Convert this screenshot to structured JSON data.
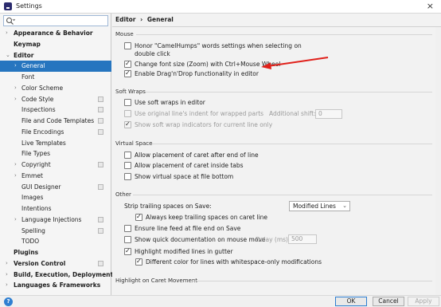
{
  "window": {
    "title": "Settings"
  },
  "search": {
    "placeholder": ""
  },
  "breadcrumb": {
    "parent": "Editor",
    "separator": "›",
    "current": "General"
  },
  "sidebar": {
    "items": [
      {
        "label": "Appearance & Behavior",
        "arrow": "›",
        "bold": true
      },
      {
        "label": "Keymap",
        "arrow": "",
        "bold": true
      },
      {
        "label": "Editor",
        "arrow": "⌄",
        "bold": true
      },
      {
        "label": "General",
        "arrow": "›",
        "bold": false,
        "selected": true
      },
      {
        "label": "Font",
        "arrow": "",
        "bold": false
      },
      {
        "label": "Color Scheme",
        "arrow": "›",
        "bold": false
      },
      {
        "label": "Code Style",
        "arrow": "›",
        "bold": false,
        "copy": true
      },
      {
        "label": "Inspections",
        "arrow": "",
        "bold": false,
        "copy": true
      },
      {
        "label": "File and Code Templates",
        "arrow": "",
        "bold": false,
        "copy": true
      },
      {
        "label": "File Encodings",
        "arrow": "",
        "bold": false,
        "copy": true
      },
      {
        "label": "Live Templates",
        "arrow": "",
        "bold": false
      },
      {
        "label": "File Types",
        "arrow": "",
        "bold": false
      },
      {
        "label": "Copyright",
        "arrow": "›",
        "bold": false,
        "copy": true
      },
      {
        "label": "Emmet",
        "arrow": "›",
        "bold": false
      },
      {
        "label": "GUI Designer",
        "arrow": "",
        "bold": false,
        "copy": true
      },
      {
        "label": "Images",
        "arrow": "",
        "bold": false
      },
      {
        "label": "Intentions",
        "arrow": "",
        "bold": false
      },
      {
        "label": "Language Injections",
        "arrow": "›",
        "bold": false,
        "copy": true
      },
      {
        "label": "Spelling",
        "arrow": "",
        "bold": false,
        "copy": true
      },
      {
        "label": "TODO",
        "arrow": "",
        "bold": false
      },
      {
        "label": "Plugins",
        "arrow": "",
        "bold": true
      },
      {
        "label": "Version Control",
        "arrow": "›",
        "bold": true,
        "copy": true
      },
      {
        "label": "Build, Execution, Deployment",
        "arrow": "›",
        "bold": true
      },
      {
        "label": "Languages & Frameworks",
        "arrow": "›",
        "bold": true
      }
    ]
  },
  "sections": {
    "mouse": {
      "title": "Mouse",
      "camelhumps_line1": "Honor \"CamelHumps\" words settings when selecting on",
      "camelhumps_line2": "double click",
      "zoom": "Change font size (Zoom) with Ctrl+Mouse Wheel",
      "dragdrop": "Enable Drag'n'Drop functionality in editor"
    },
    "soft_wraps": {
      "title": "Soft Wraps",
      "use_soft_wraps": "Use soft wraps in editor",
      "original_indent": "Use original line's indent for wrapped parts",
      "additional_shift_label": "Additional shift:",
      "additional_shift_value": "0",
      "show_indicators": "Show soft wrap indicators for current line only"
    },
    "virtual_space": {
      "title": "Virtual Space",
      "after_eol": "Allow placement of caret after end of line",
      "inside_tabs": "Allow placement of caret inside tabs",
      "at_bottom": "Show virtual space at file bottom"
    },
    "other": {
      "title": "Other",
      "strip_label": "Strip trailing spaces on Save:",
      "strip_value": "Modified Lines",
      "keep_trailing": "Always keep trailing spaces on caret line",
      "line_feed": "Ensure line feed at file end on Save",
      "quick_doc": "Show quick documentation on mouse move",
      "delay_label": "Delay (ms):",
      "delay_value": "500",
      "highlight_gutter": "Highlight modified lines in gutter",
      "different_color": "Different color for lines with whitespace-only modifications"
    },
    "caret_movement": {
      "title": "Highlight on Caret Movement"
    }
  },
  "buttons": {
    "ok": "OK",
    "cancel": "Cancel",
    "apply": "Apply",
    "help": "?"
  },
  "colors": {
    "selection": "#2675bf",
    "annotation_arrow": "#e0201a",
    "help": "#2f7fd1"
  },
  "icons": {
    "search": "search-icon",
    "close": "close-icon",
    "copy": "copy-icon",
    "help": "help-icon"
  }
}
